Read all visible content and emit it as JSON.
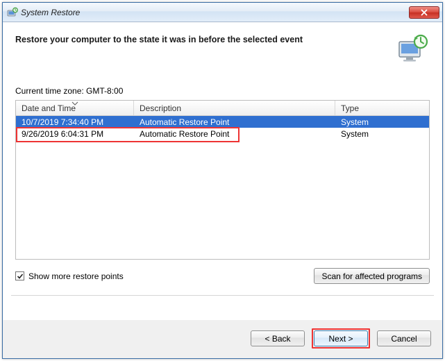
{
  "titlebar": {
    "title": "System Restore"
  },
  "header": {
    "heading": "Restore your computer to the state it was in before the selected event"
  },
  "timezone_line": "Current time zone: GMT-8:00",
  "columns": {
    "date": "Date and Time",
    "desc": "Description",
    "type": "Type"
  },
  "rows": [
    {
      "date": "10/7/2019 7:34:40 PM",
      "desc": "Automatic Restore Point",
      "type": "System",
      "selected": true
    },
    {
      "date": "9/26/2019 6:04:31 PM",
      "desc": "Automatic Restore Point",
      "type": "System",
      "highlighted": true
    }
  ],
  "show_more": {
    "label": "Show more restore points",
    "checked": true
  },
  "scan_button": "Scan for affected programs",
  "buttons": {
    "back": "< Back",
    "next": "Next >",
    "cancel": "Cancel"
  }
}
